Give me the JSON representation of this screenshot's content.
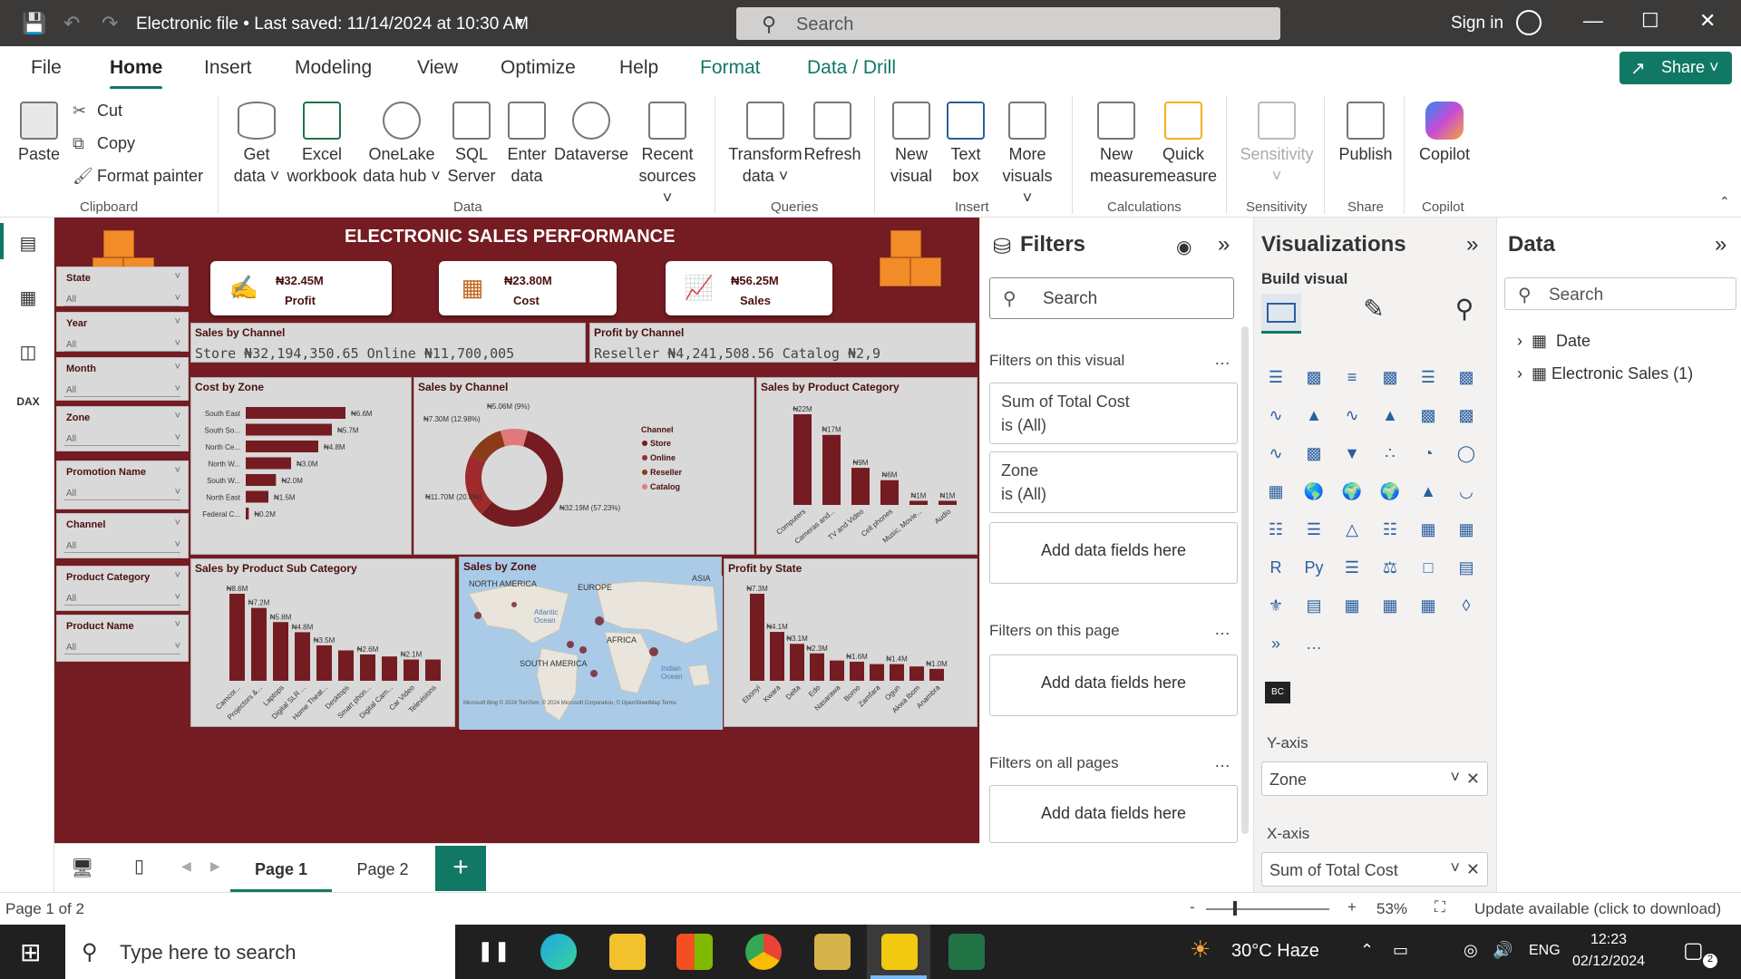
{
  "titlebar": {
    "title": "Electronic file • Last saved: 11/14/2024 at 10:30 AM",
    "search_placeholder": "Search",
    "signin": "Sign in"
  },
  "tabs": [
    "File",
    "Home",
    "Insert",
    "Modeling",
    "View",
    "Optimize",
    "Help",
    "Format",
    "Data / Drill"
  ],
  "share_label": "Share",
  "ribbon": {
    "clipboard": {
      "paste": "Paste",
      "cut": "Cut",
      "copy": "Copy",
      "format_painter": "Format painter",
      "group": "Clipboard"
    },
    "data": {
      "get_data": [
        "Get",
        "data ˅"
      ],
      "excel": [
        "Excel",
        "workbook"
      ],
      "onelake": [
        "OneLake",
        "data hub ˅"
      ],
      "sql": [
        "SQL",
        "Server"
      ],
      "enter": [
        "Enter",
        "data"
      ],
      "dataverse": "Dataverse",
      "recent": [
        "Recent",
        "sources ˅"
      ],
      "group": "Data"
    },
    "queries": {
      "transform": [
        "Transform",
        "data ˅"
      ],
      "refresh": "Refresh",
      "group": "Queries"
    },
    "insert": {
      "new_visual": [
        "New",
        "visual"
      ],
      "text_box": [
        "Text",
        "box"
      ],
      "more_visuals": [
        "More",
        "visuals ˅"
      ],
      "group": "Insert"
    },
    "calculations": {
      "new_measure": [
        "New",
        "measure"
      ],
      "quick_measure": [
        "Quick",
        "measure"
      ],
      "group": "Calculations"
    },
    "sensitivity": {
      "label": "Sensitivity",
      "group": "Sensitivity"
    },
    "share": {
      "publish": "Publish",
      "group": "Share"
    },
    "copilot": {
      "label": "Copilot",
      "group": "Copilot"
    }
  },
  "report": {
    "title": "ELECTRONIC SALES PERFORMANCE",
    "kpis": [
      {
        "value": "₦32.45M",
        "label": "Profit"
      },
      {
        "value": "₦23.80M",
        "label": "Cost"
      },
      {
        "value": "₦56.25M",
        "label": "Sales"
      }
    ],
    "slicers": [
      {
        "label": "State",
        "value": "All"
      },
      {
        "label": "Year",
        "value": "All"
      },
      {
        "label": "Month",
        "value": "All"
      },
      {
        "label": "Zone",
        "value": "All"
      },
      {
        "label": "Promotion Name",
        "value": "All"
      },
      {
        "label": "Channel",
        "value": "All"
      },
      {
        "label": "Product Category",
        "value": "All"
      },
      {
        "label": "Product Name",
        "value": "All"
      }
    ],
    "sales_by_channel_card": {
      "title": "Sales by Channel",
      "text": "Store ₦32,194,350.65   Online ₦11,700,005"
    },
    "profit_by_channel_card": {
      "title": "Profit by Channel",
      "text": "Reseller ₦4,241,508.56    Catalog ₦2,9"
    },
    "map": {
      "title": "Sales by Zone",
      "labels": [
        "NORTH AMERICA",
        "EUROPE",
        "ASIA",
        "Atlantic Ocean",
        "AFRICA",
        "SOUTH AMERICA",
        "Indian Ocean"
      ],
      "attribution": "Microsoft Bing  © 2024 TomTom, © 2024 Microsoft Corporation, © OpenStreetMap  Terms"
    }
  },
  "chart_data": [
    {
      "type": "bar",
      "orientation": "horizontal",
      "title": "Cost by Zone",
      "categories": [
        "South East",
        "South So...",
        "North Ce...",
        "North W...",
        "South W...",
        "North East",
        "Federal C..."
      ],
      "values": [
        6.6,
        5.7,
        4.8,
        3.0,
        2.0,
        1.5,
        0.2
      ],
      "labels": [
        "₦6.6M",
        "₦5.7M",
        "₦4.8M",
        "₦3.0M",
        "₦2.0M",
        "₦1.5M",
        "₦0.2M"
      ],
      "color": "#741c22"
    },
    {
      "type": "pie",
      "donut": true,
      "title": "Sales by Channel",
      "legend_title": "Channel",
      "categories": [
        "Store",
        "Online",
        "Reseller",
        "Catalog"
      ],
      "values": [
        32.19,
        11.7,
        7.3,
        5.06
      ],
      "labels": [
        "₦32.19M (57.23%)",
        "₦11.70M (20.8%)",
        "₦7.30M (12.98%)",
        "₦5.06M (9%)"
      ],
      "colors": [
        "#741c22",
        "#9e2a2b",
        "#8b3a1a",
        "#e07a7a"
      ]
    },
    {
      "type": "bar",
      "title": "Sales by Product Category",
      "categories": [
        "Computers",
        "Cameras and...",
        "TV and Video",
        "Cell phones",
        "Music, Movie...",
        "Audio"
      ],
      "values": [
        22,
        17,
        9,
        6,
        1,
        1
      ],
      "labels": [
        "₦22M",
        "₦17M",
        "₦9M",
        "₦6M",
        "₦1M",
        "₦1M"
      ],
      "color": "#741c22"
    },
    {
      "type": "bar",
      "title": "Sales by Product Sub Category",
      "categories": [
        "Camcor...",
        "Projectors &...",
        "Laptops",
        "Digital SLR ...",
        "Home Theat...",
        "Desktops",
        "Smart phon...",
        "Digital Cam...",
        "Car Video",
        "Televisions"
      ],
      "values": [
        8.6,
        7.2,
        5.8,
        4.8,
        3.5,
        3.0,
        2.6,
        2.4,
        2.1,
        2.1
      ],
      "labels": [
        "₦8.6M",
        "₦7.2M",
        "₦5.8M",
        "₦4.8M",
        "₦3.5M",
        "",
        "₦2.6M",
        "",
        "₦2.1M",
        ""
      ],
      "color": "#741c22"
    },
    {
      "type": "bar",
      "title": "Profit by State",
      "categories": [
        "Ebonyi",
        "Kwara",
        "Delta",
        "Edo",
        "Nasarawa",
        "Borno",
        "Zamfara",
        "Ogun",
        "Akwa Ibom",
        "Anambra"
      ],
      "values": [
        7.3,
        4.1,
        3.1,
        2.3,
        1.7,
        1.6,
        1.4,
        1.4,
        1.2,
        1.0
      ],
      "labels": [
        "₦7.3M",
        "₦4.1M",
        "₦3.1M",
        "₦2.3M",
        "",
        "₦1.6M",
        "",
        "₦1.4M",
        "",
        "₦1.0M"
      ],
      "color": "#741c22"
    }
  ],
  "pages": {
    "tabs": [
      "Page 1",
      "Page 2"
    ],
    "add": "+"
  },
  "filters": {
    "title": "Filters",
    "search_placeholder": "Search",
    "on_visual": "Filters on this visual",
    "card1": [
      "Sum of Total Cost",
      "is (All)"
    ],
    "card2": [
      "Zone",
      "is (All)"
    ],
    "add_fields": "Add data fields here",
    "on_page": "Filters on this page",
    "on_all": "Filters on all pages"
  },
  "viz": {
    "title": "Visualizations",
    "build": "Build visual",
    "yaxis": "Y-axis",
    "yfield": "Zone",
    "xaxis": "X-axis",
    "xfield": "Sum of Total Cost"
  },
  "data_pane": {
    "title": "Data",
    "search_placeholder": "Search",
    "items": [
      "Date",
      "Electronic Sales (1)"
    ]
  },
  "status": {
    "page": "Page 1 of 2",
    "zoom": "53%",
    "update": "Update available (click to download)"
  },
  "taskbar": {
    "search_placeholder": "Type here to search",
    "weather": "30°C  Haze",
    "lang": "ENG",
    "time": "12:23",
    "date": "02/12/2024",
    "notif": "2"
  },
  "colors": {
    "accent": "#117865",
    "report_bg": "#741c22",
    "bar": "#741c22"
  }
}
